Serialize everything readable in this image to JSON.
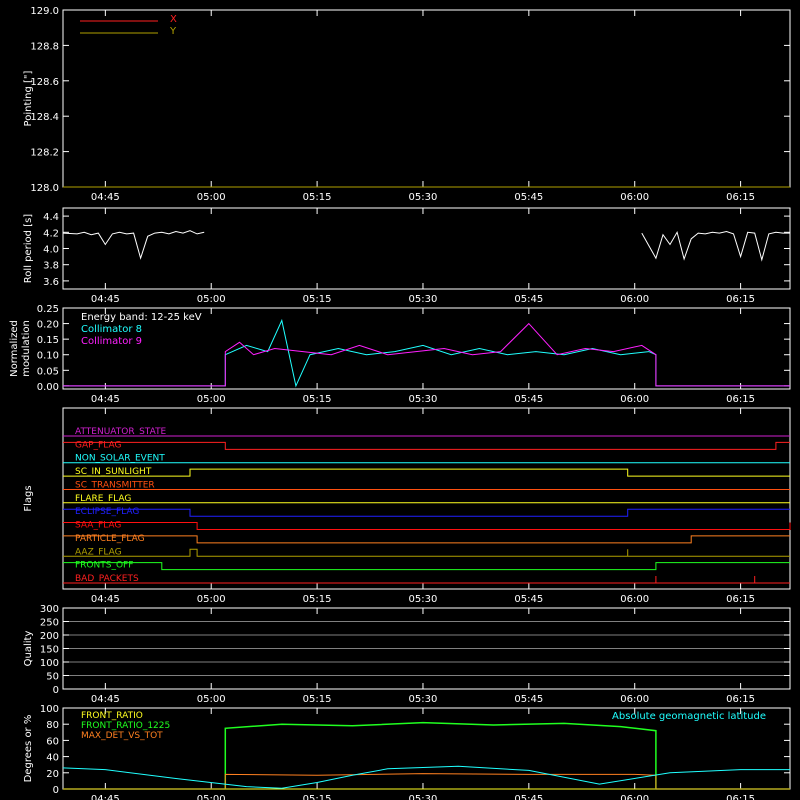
{
  "time_ticks": [
    "04:45",
    "05:00",
    "05:15",
    "05:30",
    "05:45",
    "06:00",
    "06:15"
  ],
  "colors": {
    "axis": "#ffffff",
    "red": "#ff2020",
    "olive": "#b0a000",
    "cyan": "#20ffff",
    "magenta": "#ff20ff",
    "green": "#20ff20",
    "orange": "#ff8020",
    "yellow": "#ffff20",
    "blue": "#2020ff",
    "darkorange": "#ff5010",
    "darkred": "#ff1010",
    "purple": "#d020d0"
  },
  "chart_data": [
    {
      "type": "line",
      "ylabel": "Pointing [\"]",
      "ylim": [
        128.0,
        129.0
      ],
      "yticks": [
        "128.0",
        "128.2",
        "128.4",
        "128.6",
        "128.8",
        "129.0"
      ],
      "legend_placement": "top-left",
      "series": [
        {
          "name": "X",
          "color": "red",
          "x": [
            "04:39",
            "06:22"
          ],
          "y": [
            128.0,
            128.0
          ]
        },
        {
          "name": "Y",
          "color": "olive",
          "x": [
            "04:39",
            "06:22"
          ],
          "y": [
            128.0,
            128.0
          ]
        }
      ]
    },
    {
      "type": "line",
      "ylabel": "Roll period [s]",
      "ylim": [
        3.5,
        4.5
      ],
      "yticks": [
        "3.6",
        "3.8",
        "4.0",
        "4.2",
        "4.4"
      ],
      "series": [
        {
          "name": "",
          "color": "axis",
          "x": [
            "04:39",
            "04:41",
            "04:42",
            "04:43",
            "04:44",
            "04:45",
            "04:46",
            "04:47",
            "04:48",
            "04:49",
            "04:50",
            "04:51",
            "04:52",
            "04:53",
            "04:54",
            "04:55",
            "04:56",
            "04:57",
            "04:58",
            "04:59",
            "06:01",
            "06:03",
            "06:04",
            "06:05",
            "06:06",
            "06:07",
            "06:08",
            "06:09",
            "06:10",
            "06:11",
            "06:12",
            "06:13",
            "06:14",
            "06:15",
            "06:16",
            "06:17",
            "06:18",
            "06:19",
            "06:20",
            "06:21",
            "06:22"
          ],
          "y": [
            4.19,
            4.18,
            4.2,
            4.17,
            4.19,
            4.05,
            4.18,
            4.2,
            4.18,
            4.19,
            3.88,
            4.15,
            4.19,
            4.2,
            4.18,
            4.21,
            4.19,
            4.22,
            4.18,
            4.2,
            4.19,
            3.88,
            4.17,
            4.05,
            4.2,
            3.87,
            4.12,
            4.19,
            4.18,
            4.2,
            4.19,
            4.21,
            4.18,
            3.9,
            4.2,
            4.19,
            3.86,
            4.18,
            4.2,
            4.19,
            4.19
          ]
        }
      ]
    },
    {
      "type": "line",
      "ylabel": "Normalized modulation",
      "ylim": [
        -0.01,
        0.25
      ],
      "yticks": [
        "0.00",
        "0.05",
        "0.10",
        "0.15",
        "0.20",
        "0.25"
      ],
      "annotations": [
        "Energy band: 12-25 keV"
      ],
      "series": [
        {
          "name": "Collimator 8",
          "color": "cyan",
          "x": [
            "04:39",
            "05:02",
            "05:02",
            "05:05",
            "05:08",
            "05:10",
            "05:12",
            "05:14",
            "05:18",
            "05:22",
            "05:26",
            "05:30",
            "05:34",
            "05:38",
            "05:42",
            "05:46",
            "05:50",
            "05:54",
            "05:58",
            "06:02",
            "06:03",
            "06:03",
            "06:22"
          ],
          "y": [
            0.0,
            0.0,
            0.1,
            0.13,
            0.11,
            0.21,
            0.0,
            0.1,
            0.12,
            0.1,
            0.11,
            0.13,
            0.1,
            0.12,
            0.1,
            0.11,
            0.1,
            0.12,
            0.1,
            0.11,
            0.1,
            0.0,
            0.0
          ]
        },
        {
          "name": "Collimator 9",
          "color": "magenta",
          "x": [
            "04:39",
            "05:02",
            "05:02",
            "05:04",
            "05:06",
            "05:09",
            "05:13",
            "05:17",
            "05:21",
            "05:25",
            "05:29",
            "05:33",
            "05:37",
            "05:41",
            "05:45",
            "05:49",
            "05:53",
            "05:57",
            "06:01",
            "06:03",
            "06:03",
            "06:22"
          ],
          "y": [
            0.0,
            0.0,
            0.11,
            0.14,
            0.1,
            0.12,
            0.11,
            0.1,
            0.13,
            0.1,
            0.11,
            0.12,
            0.1,
            0.11,
            0.2,
            0.1,
            0.12,
            0.11,
            0.13,
            0.1,
            0.0,
            0.0
          ]
        }
      ]
    },
    {
      "type": "line",
      "ylabel": "Flags",
      "series": [
        {
          "name": "ATTENUATOR_STATE",
          "color": "purple",
          "x": [
            "04:39",
            "06:22"
          ],
          "y": [
            0,
            0
          ]
        },
        {
          "name": "GAP_FLAG",
          "color": "red",
          "x": [
            "04:39",
            "05:02",
            "05:02",
            "06:20",
            "06:20",
            "06:22"
          ],
          "y": [
            1,
            1,
            0,
            0,
            1,
            1
          ]
        },
        {
          "name": "NON_SOLAR_EVENT",
          "color": "cyan",
          "x": [
            "04:39",
            "06:22"
          ],
          "y": [
            0,
            0
          ]
        },
        {
          "name": "SC_IN_SUNLIGHT",
          "color": "yellow",
          "x": [
            "04:39",
            "04:57",
            "04:57",
            "05:59",
            "05:59",
            "06:22"
          ],
          "y": [
            0,
            0,
            1,
            1,
            0,
            0
          ]
        },
        {
          "name": "SC_TRANSMITTER",
          "color": "darkorange",
          "x": [
            "04:39",
            "06:22"
          ],
          "y": [
            0,
            0
          ]
        },
        {
          "name": "FLARE_FLAG",
          "color": "yellow",
          "x": [
            "04:39",
            "06:22"
          ],
          "y": [
            0,
            0
          ]
        },
        {
          "name": "ECLIPSE_FLAG",
          "color": "blue",
          "x": [
            "04:39",
            "04:57",
            "04:57",
            "05:59",
            "05:59",
            "06:22"
          ],
          "y": [
            1,
            1,
            0,
            0,
            1,
            1
          ]
        },
        {
          "name": "SAA_FLAG",
          "color": "darkred",
          "x": [
            "04:39",
            "04:58",
            "04:58",
            "06:22",
            "06:22"
          ],
          "y": [
            1,
            1,
            0,
            0,
            1
          ]
        },
        {
          "name": "PARTICLE_FLAG",
          "color": "orange",
          "x": [
            "04:39",
            "04:58",
            "04:58",
            "06:08",
            "06:08",
            "06:22"
          ],
          "y": [
            1,
            1,
            0,
            0,
            1,
            1
          ]
        },
        {
          "name": "AAZ_FLAG",
          "color": "olive",
          "x": [
            "04:39",
            "04:57",
            "04:57",
            "04:58",
            "04:58",
            "05:59",
            "05:59",
            "05:59",
            "05:59",
            "06:22"
          ],
          "y": [
            0,
            0,
            1,
            1,
            0,
            0,
            1,
            1,
            0,
            0
          ]
        },
        {
          "name": "FRONTS_OFF",
          "color": "green",
          "x": [
            "04:39",
            "04:53",
            "04:53",
            "06:03",
            "06:03",
            "06:22"
          ],
          "y": [
            1,
            1,
            0,
            0,
            1,
            1
          ]
        },
        {
          "name": "BAD_PACKETS",
          "color": "red",
          "x": [
            "04:39",
            "06:03",
            "06:03",
            "06:03",
            "06:17",
            "06:17",
            "06:17",
            "06:22"
          ],
          "y": [
            0,
            0,
            1,
            0,
            0,
            1,
            0,
            0
          ]
        }
      ]
    },
    {
      "type": "line",
      "ylabel": "Quality",
      "ylim": [
        0,
        300
      ],
      "yticks": [
        "0",
        "50",
        "100",
        "150",
        "200",
        "250",
        "300"
      ],
      "series": []
    },
    {
      "type": "line",
      "ylabel": "Degrees or %",
      "ylim": [
        0,
        100
      ],
      "yticks": [
        "0",
        "20",
        "40",
        "60",
        "80",
        "100"
      ],
      "annotations": [
        "Absolute geomagnetic latitude"
      ],
      "series": [
        {
          "name": "FRONT_RATIO",
          "color": "yellow",
          "x": [
            "04:39",
            "06:22"
          ],
          "y": [
            0,
            0
          ]
        },
        {
          "name": "FRONT_RATIO_1225",
          "color": "green",
          "x": [
            "04:39",
            "05:02",
            "05:02",
            "05:10",
            "05:20",
            "05:30",
            "05:40",
            "05:50",
            "05:58",
            "06:03",
            "06:03",
            "06:22"
          ],
          "y": [
            0,
            0,
            75,
            80,
            78,
            82,
            79,
            81,
            77,
            72,
            0,
            0
          ]
        },
        {
          "name": "MAX_DET_VS_TOT",
          "color": "orange",
          "x": [
            "04:39",
            "05:02",
            "05:02",
            "05:15",
            "05:30",
            "05:45",
            "06:00",
            "06:03",
            "06:03",
            "06:22"
          ],
          "y": [
            0,
            0,
            18,
            17,
            19,
            18,
            18,
            17,
            0,
            0
          ]
        },
        {
          "name": "Absolute geomagnetic latitude",
          "color": "cyan",
          "x": [
            "04:39",
            "04:45",
            "04:55",
            "05:05",
            "05:10",
            "05:15",
            "05:20",
            "05:25",
            "05:35",
            "05:45",
            "05:55",
            "06:05",
            "06:15",
            "06:22"
          ],
          "y": [
            26,
            24,
            13,
            3,
            1,
            8,
            17,
            25,
            28,
            23,
            6,
            20,
            24,
            24
          ]
        }
      ]
    }
  ]
}
